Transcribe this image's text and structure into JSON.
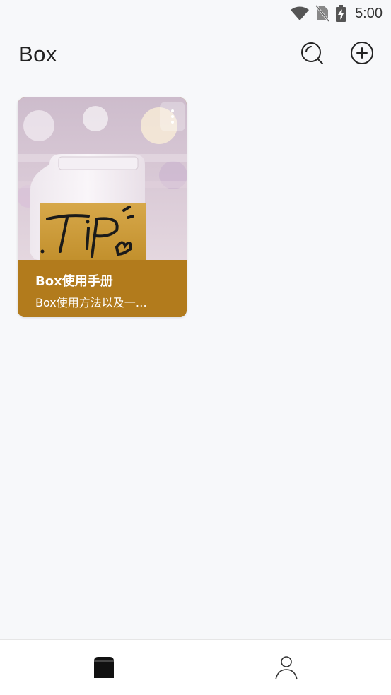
{
  "status_bar": {
    "time": "5:00",
    "icons": [
      "wifi-icon",
      "no-sim-icon",
      "battery-charging-icon"
    ]
  },
  "header": {
    "title": "Box",
    "actions": [
      "search-icon",
      "add-circle-icon"
    ]
  },
  "cards": [
    {
      "image_label": "TiP",
      "title": "Box使用手册",
      "description": "Box使用方法以及一…",
      "menu_icon": "more-vertical-icon"
    }
  ],
  "bottom_nav": {
    "items": [
      "box-tab-icon",
      "profile-tab-icon"
    ],
    "active": "box-tab-icon"
  },
  "colors": {
    "background": "#f7f8fa",
    "card_accent": "#b27b1c",
    "icon_dark": "#222222"
  }
}
